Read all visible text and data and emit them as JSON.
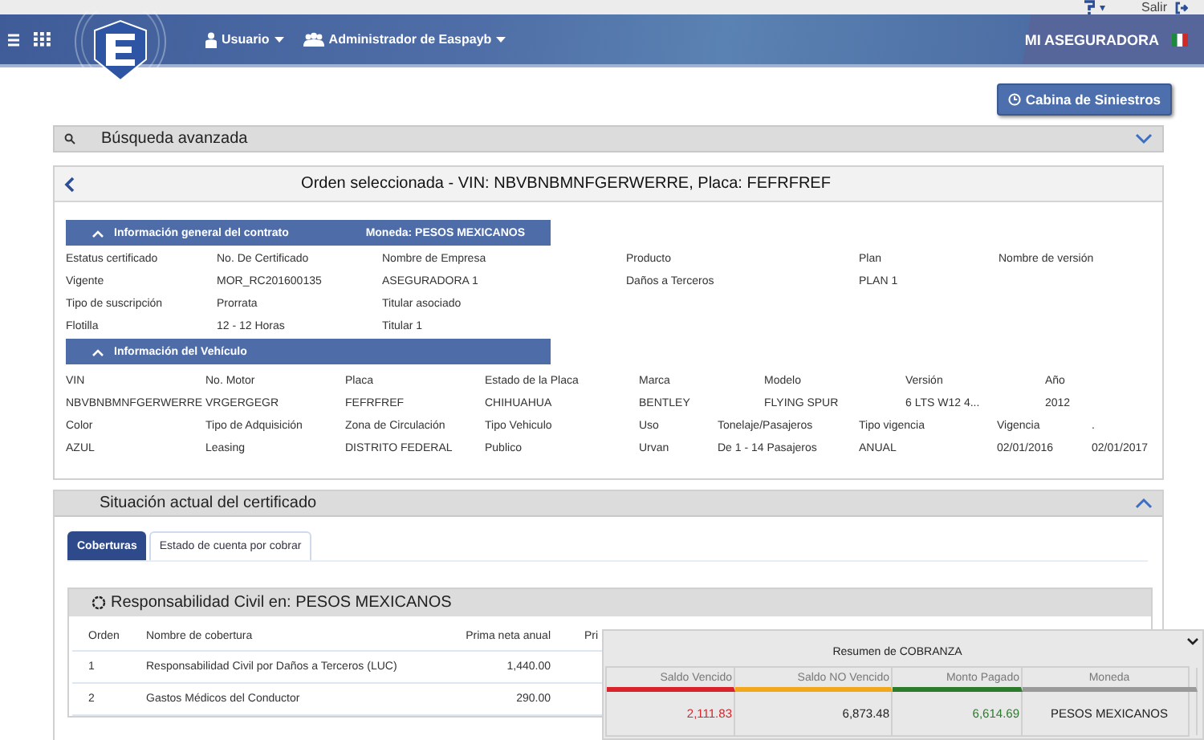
{
  "topbar": {
    "help_caret": "▾",
    "logout": "Salir"
  },
  "header": {
    "menus": [
      {
        "label": "Usuario",
        "kind": "user"
      },
      {
        "label": "Administrador de Easpayb",
        "kind": "group"
      }
    ],
    "company": "MI ASEGURADORA"
  },
  "cabina_button": "Cabina de Siniestros",
  "search": {
    "title": "Búsqueda avanzada",
    "expanded": false
  },
  "order": {
    "title": "Orden seleccionada - VIN: NBVBNBMNFGERWERRE, Placa: FEFRFREF",
    "contract": {
      "title": "Información general del contrato",
      "currency": "Moneda: PESOS MEXICANOS",
      "expanded": true,
      "rows": [
        [
          "Estatus certificado",
          "No. De Certificado",
          "Nombre de Empresa",
          "Producto",
          "Plan",
          "Nombre de versión"
        ],
        [
          "Vigente",
          "MOR_RC201600135",
          "ASEGURADORA 1",
          "Daños a Terceros",
          "PLAN 1"
        ],
        [
          "Tipo de suscripción",
          "Prorrata",
          "Titular asociado"
        ],
        [
          "Flotilla",
          "12 - 12 Horas",
          "Titular 1"
        ]
      ]
    },
    "vehicle": {
      "title": "Información del Vehículo",
      "expanded": true,
      "rows": [
        [
          "VIN",
          "No. Motor",
          "Placa",
          "Estado de la Placa",
          "Marca",
          "Modelo",
          "Versión",
          "Año"
        ],
        [
          "NBVBNBMNFGERWERRE",
          "VRGERGEGR",
          "FEFRFREF",
          "CHIHUAHUA",
          "BENTLEY",
          "FLYING SPUR",
          "6 LTS W12 4...",
          "2012"
        ],
        [
          "Color",
          "Tipo de Adquisición",
          "Zona de Circulación",
          "Tipo Vehiculo",
          "Uso",
          "Tonelaje/Pasajeros",
          "Tipo vigencia",
          "Vigencia",
          "."
        ],
        [
          "AZUL",
          "Leasing",
          "DISTRITO FEDERAL",
          "Publico",
          "Urvan",
          "De 1 - 14 Pasajeros",
          "ANUAL",
          "02/01/2016",
          "02/01/2017"
        ]
      ]
    }
  },
  "situation": {
    "title": "Situación actual del certificado",
    "expanded": true,
    "tabs": [
      {
        "label": "Coberturas",
        "selected": true
      },
      {
        "label": "Estado de cuenta por cobrar",
        "selected": false
      }
    ],
    "coverage": {
      "title": "Responsabilidad Civil en: PESOS MEXICANOS",
      "columns": [
        "Orden",
        "Nombre de cobertura",
        "Prima neta anual",
        "Pri"
      ],
      "rows": [
        [
          "1",
          "Responsabilidad Civil por Daños a Terceros (LUC)",
          "1,440.00"
        ],
        [
          "2",
          "Gastos Médicos del Conductor",
          "290.00"
        ]
      ]
    }
  },
  "collection": {
    "title": "Resumen de COBRANZA",
    "columns": [
      {
        "label": "Saldo Vencido",
        "value": "2,111.83",
        "color": "#d9232a",
        "colored_value": true
      },
      {
        "label": "Saldo NO Vencido",
        "value": "6,873.48",
        "color": "#f2a81d",
        "colored_value": false
      },
      {
        "label": "Monto Pagado",
        "value": "6,614.69",
        "color": "#2c7a2c",
        "colored_value": true
      },
      {
        "label": "Moneda",
        "value": "PESOS MEXICANOS",
        "color": "#9a9a9a"
      }
    ]
  }
}
